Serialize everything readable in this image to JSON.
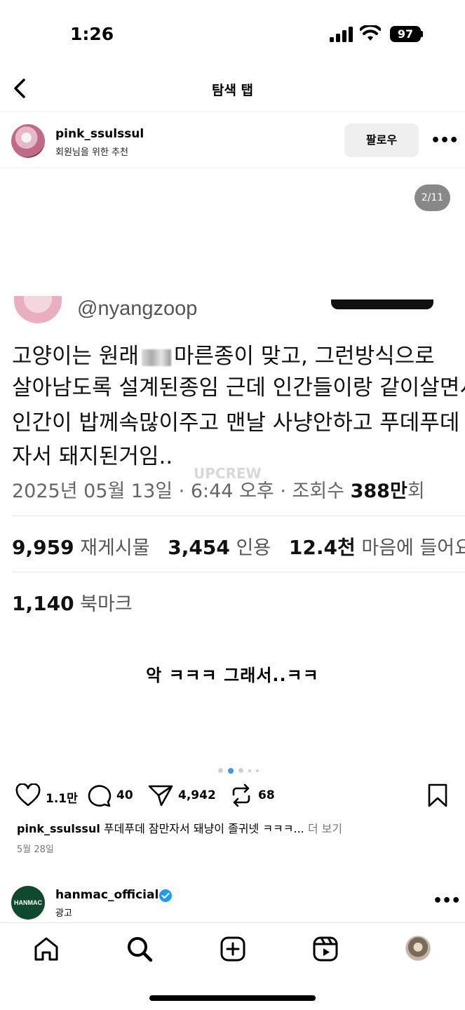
{
  "status_bar": {
    "time": "1:26",
    "battery": "97"
  },
  "header": {
    "title": "탐색 탭"
  },
  "post": {
    "username": "pink_ssulssul",
    "subtitle": "회원님을 위한 추천",
    "follow_label": "팔로우",
    "more_label": "•••",
    "image_counter": "2/11",
    "tweet": {
      "handle": "@nyangzoop",
      "line1_a": "고양이는 원래",
      "line1_b": "마른종이 맞고, 그런방식으로",
      "line2": "살아남도록 설계된종임  근데 인간들이랑 같이살면서",
      "line3": "인간이 밥께속많이주고 맨날 사냥안하고 푸데푸데",
      "line4": "자서 돼지된거임..",
      "meta_prefix": "2025년 05월 13일 · 6:44 오후 · 조회수 ",
      "views": "388만",
      "views_suffix": "회",
      "retweets_count": "9,959",
      "retweets_label": "재게시물",
      "quotes_count": "3,454",
      "quotes_label": "인용",
      "likes_count": "12.4천",
      "likes_label": "마음에 들어요",
      "bookmarks_count": "1,140",
      "bookmarks_label": "북마크"
    },
    "watermark": "UPCREW",
    "image_caption": "악 ㅋㅋㅋ 그래서..ㅋㅋ",
    "likes": "1.1만",
    "comments": "40",
    "shares": "4,942",
    "reposts": "68",
    "caption_user": "pink_ssulssul",
    "caption_text": "푸데푸데 잠만자서 돼냥이 졸귀넷 ㅋㅋㅋ...",
    "caption_more": "더 보기",
    "date": "5월 28일"
  },
  "next_post": {
    "logo_text": "HANMAC",
    "username": "hanmac_official",
    "label": "광고",
    "more_label": "•••"
  },
  "tabbar": {
    "icons": [
      "home-icon",
      "search-icon",
      "add-icon",
      "reels-icon",
      "profile-avatar"
    ]
  },
  "colors": {
    "accent": "#3897f0",
    "verified": "#1d9bf0",
    "hanmac_green": "#0f4a2e"
  }
}
